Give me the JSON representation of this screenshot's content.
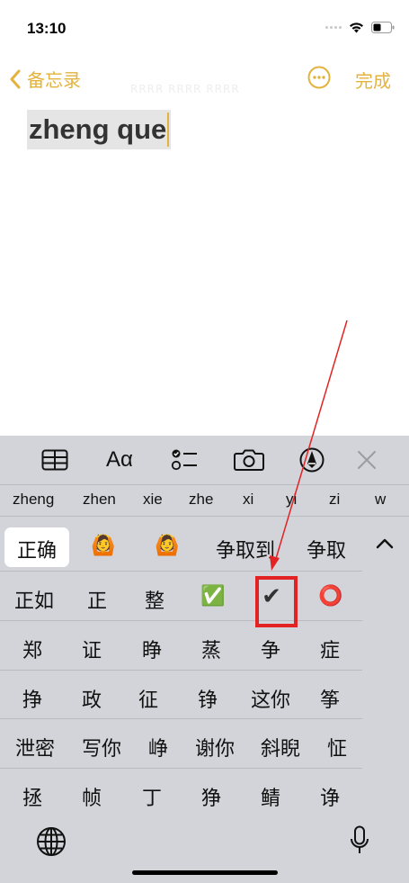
{
  "status_bar": {
    "time": "13:10"
  },
  "nav": {
    "back_label": "备忘录",
    "done_label": "完成",
    "faint_text": "RRRR RRRR RRRR"
  },
  "note": {
    "text": "zheng que"
  },
  "keyboard": {
    "toolbar": {
      "aa_label": "Aα"
    },
    "pinyin": [
      "zheng",
      "zhen",
      "xie",
      "zhe",
      "xi",
      "yi",
      "zi",
      "w"
    ],
    "row1": [
      "正确",
      "🙆",
      "🙆",
      "争取到",
      "争取"
    ],
    "grid": [
      [
        "正如",
        "正",
        "整",
        "✅",
        "✔",
        "⭕"
      ],
      [
        "郑",
        "证",
        "睁",
        "蒸",
        "争",
        "症"
      ],
      [
        "挣",
        "政",
        "征",
        "铮",
        "这你",
        "筝"
      ],
      [
        "泄密",
        "写你",
        "峥",
        "谢你",
        "斜睨",
        "怔"
      ],
      [
        "拯",
        "帧",
        "丁",
        "狰",
        "鲭",
        "诤"
      ]
    ]
  },
  "colors": {
    "accent": "#e3b33d",
    "annotation": "#e32323",
    "keyboard_bg": "#d2d4d9"
  }
}
